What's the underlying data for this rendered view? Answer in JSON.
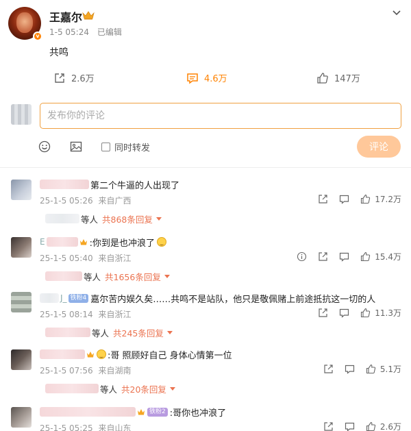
{
  "post": {
    "author": "王嘉尔",
    "verified_badge": "v",
    "timestamp": "1-5 05:24",
    "edited": "已编辑",
    "content": "共鸣",
    "icons": {
      "crown": "crown-icon",
      "more": "chevron-down-icon"
    }
  },
  "actions": {
    "repost": {
      "count": "2.6万",
      "icon": "repost-icon"
    },
    "comment": {
      "count": "4.6万",
      "icon": "comment-icon"
    },
    "like": {
      "count": "147万",
      "icon": "thumbs-up-icon"
    }
  },
  "compose": {
    "placeholder": "发布你的评论",
    "sync_label": "同时转发",
    "submit_label": "评论"
  },
  "colors": {
    "accent": "#ff8200",
    "reply_link": "#eb7350",
    "submit_disabled": "#ffc89a"
  },
  "comments": [
    {
      "name": "",
      "tag": "",
      "text": "第二个牛逼的人出现了",
      "time": "25-1-5 05:26",
      "location": "来自广西",
      "likes": "17.2万",
      "reply_prefix": "等人",
      "replies": "共868条回复"
    },
    {
      "name": "E",
      "tag": "",
      "text": ":你到是也冲浪了",
      "time": "25-1-5 05:40",
      "location": "来自浙江",
      "likes": "15.4万",
      "reply_prefix": "等人",
      "replies": "共1656条回复"
    },
    {
      "name": "J_",
      "tag": "铁粉4",
      "text": "嘉尔苦内娱久矣……共鸣不是站队，他只是敬佩赌上前途抵抗这一切的人",
      "time": "25-1-5 08:14",
      "location": "来自浙江",
      "likes": "11.3万",
      "reply_prefix": "等人",
      "replies": "共245条回复"
    },
    {
      "name": "",
      "tag": "",
      "text": ":哥 照顾好自己 身体心情第一位",
      "time": "25-1-5 07:56",
      "location": "来自湖南",
      "likes": "5.1万",
      "reply_prefix": "等人",
      "replies": "共20条回复"
    },
    {
      "name": "",
      "tag": "铁粉2",
      "text": ":哥你也冲浪了",
      "time": "25-1-5 05:25",
      "location": "来自山东",
      "likes": "2.6万",
      "reply_prefix": "",
      "replies": ""
    }
  ]
}
